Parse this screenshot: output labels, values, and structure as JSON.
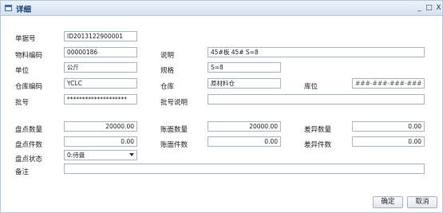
{
  "window": {
    "title": "详细",
    "controls": [
      "_",
      "□",
      "X"
    ]
  },
  "form": {
    "doc_no": {
      "label": "单据号",
      "value": "ID2013122900001"
    },
    "material_code": {
      "label": "物料编码",
      "value": "00000186"
    },
    "description": {
      "label": "说明",
      "value": "45#板 45# S=8"
    },
    "unit": {
      "label": "单位",
      "value": "公斤"
    },
    "spec": {
      "label": "规格",
      "value": "S=8"
    },
    "wh_code": {
      "label": "仓库编码",
      "value": "YCLC"
    },
    "warehouse": {
      "label": "仓库",
      "value": "原材料仓"
    },
    "location": {
      "label": "库位",
      "placeholder": "###-###-###-###"
    },
    "batch_no": {
      "label": "批号",
      "value": "********************"
    },
    "batch_desc": {
      "label": "批号说明",
      "value": ""
    },
    "count_qty": {
      "label": "盘点数量",
      "value": "20000.00"
    },
    "book_qty": {
      "label": "账面数量",
      "value": "20000.00"
    },
    "diff_qty": {
      "label": "差异数量",
      "value": "0.00"
    },
    "count_pcs": {
      "label": "盘点件数",
      "value": "0.00"
    },
    "book_pcs": {
      "label": "账面件数",
      "value": "0.00"
    },
    "diff_pcs": {
      "label": "差异件数",
      "value": "0.00"
    },
    "status": {
      "label": "盘点状态",
      "value": "0:待盘"
    },
    "remark": {
      "label": "备注",
      "value": ""
    }
  },
  "buttons": {
    "ok": "确定",
    "cancel": "取消"
  }
}
